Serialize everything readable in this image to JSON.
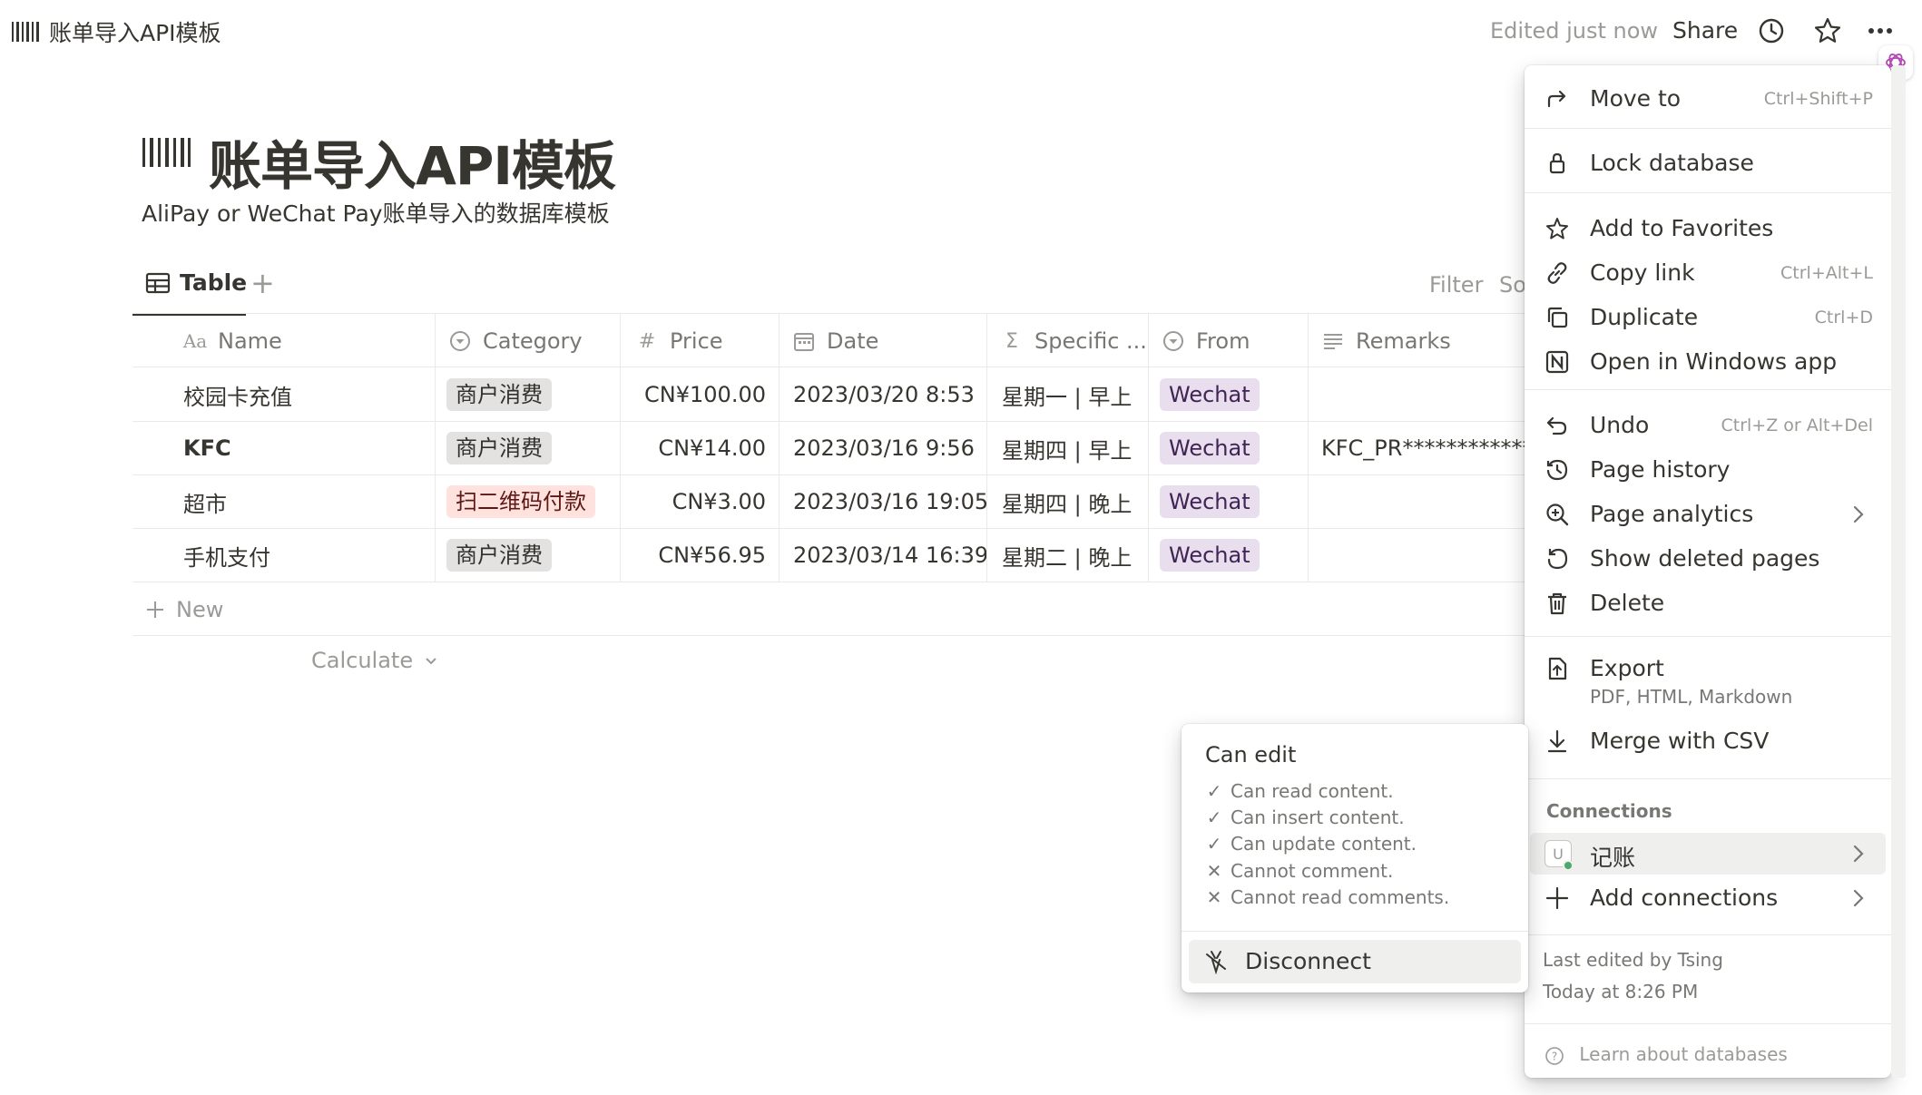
{
  "topbar": {
    "breadcrumb_title": "账单导入API模板",
    "edited_status": "Edited just now",
    "share_label": "Share"
  },
  "page": {
    "title": "账单导入API模板",
    "description": "AliPay or WeChat Pay账单导入的数据库模板"
  },
  "views": {
    "active_tab": "Table",
    "add_view": "+",
    "filter_label": "Filter",
    "sort_label": "Sort"
  },
  "table": {
    "columns": [
      {
        "icon": "Aa",
        "label": "Name"
      },
      {
        "icon": "select",
        "label": "Category"
      },
      {
        "icon": "#",
        "label": "Price"
      },
      {
        "icon": "calendar",
        "label": "Date"
      },
      {
        "icon": "Σ",
        "label": "Specific ..."
      },
      {
        "icon": "select",
        "label": "From"
      },
      {
        "icon": "text",
        "label": "Remarks"
      }
    ],
    "rows": [
      {
        "name": "校园卡充值",
        "category": "商户消费",
        "category_color": "gray",
        "price": "CN¥100.00",
        "date": "2023/03/20 8:53",
        "specific": "星期一 | 早上",
        "from": "Wechat",
        "remarks": ""
      },
      {
        "name": "KFC",
        "category": "商户消费",
        "category_color": "gray",
        "price": "CN¥14.00",
        "date": "2023/03/16 9:56",
        "specific": "星期四 | 早上",
        "from": "Wechat",
        "remarks": "KFC_PR**************"
      },
      {
        "name": "超市",
        "category": "扫二维码付款",
        "category_color": "red",
        "price": "CN¥3.00",
        "date": "2023/03/16 19:05",
        "specific": "星期四 | 晚上",
        "from": "Wechat",
        "remarks": ""
      },
      {
        "name": "手机支付",
        "category": "商户消费",
        "category_color": "gray",
        "price": "CN¥56.95",
        "date": "2023/03/14 16:39",
        "specific": "星期二 | 晚上",
        "from": "Wechat",
        "remarks": ""
      }
    ],
    "new_row_label": "New",
    "calculate_label": "Calculate"
  },
  "menu": {
    "move_to": {
      "label": "Move to",
      "shortcut": "Ctrl+Shift+P"
    },
    "lock": {
      "label": "Lock database"
    },
    "favorites": {
      "label": "Add to Favorites"
    },
    "copy_link": {
      "label": "Copy link",
      "shortcut": "Ctrl+Alt+L"
    },
    "duplicate": {
      "label": "Duplicate",
      "shortcut": "Ctrl+D"
    },
    "open_app": {
      "label": "Open in Windows app"
    },
    "undo": {
      "label": "Undo",
      "shortcut": "Ctrl+Z or Alt+Del"
    },
    "page_history": {
      "label": "Page history"
    },
    "page_analytics": {
      "label": "Page analytics"
    },
    "show_deleted": {
      "label": "Show deleted pages"
    },
    "delete": {
      "label": "Delete"
    },
    "export": {
      "label": "Export",
      "sub": "PDF, HTML, Markdown"
    },
    "merge_csv": {
      "label": "Merge with CSV"
    },
    "connections_heading": "Connections",
    "connection_item": {
      "label": "记账",
      "avatar": "U"
    },
    "add_connections": {
      "label": "Add connections"
    },
    "last_edited_by": "Last edited by Tsing",
    "last_edited_time": "Today at 8:26 PM",
    "learn": "Learn about databases"
  },
  "submenu": {
    "title": "Can edit",
    "permissions": [
      {
        "allowed": true,
        "text": "Can read content."
      },
      {
        "allowed": true,
        "text": "Can insert content."
      },
      {
        "allowed": true,
        "text": "Can update content."
      },
      {
        "allowed": false,
        "text": "Cannot comment."
      },
      {
        "allowed": false,
        "text": "Cannot read comments."
      }
    ],
    "disconnect_label": "Disconnect"
  },
  "colors": {
    "tag_gray": "#e3e2e0",
    "tag_red": "#ffe2dd",
    "tag_purple": "#e8deee",
    "text_primary": "#37352f",
    "text_secondary": "#787774",
    "online_dot": "#4ca86b"
  }
}
